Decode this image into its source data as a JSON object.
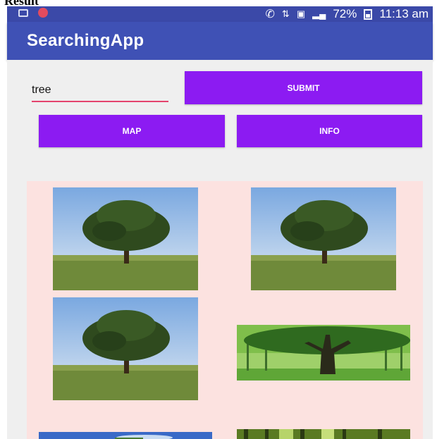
{
  "caption": "Result",
  "status_bar": {
    "battery": "72%",
    "time": "11:13 am",
    "icons": [
      "image-icon",
      "record-icon",
      "call-icon",
      "data-icon",
      "sim-icon",
      "signal-icon",
      "battery-icon"
    ]
  },
  "app": {
    "title": "SearchingApp",
    "accent_color": "#8c1bf2",
    "appbar_color": "#3f51b5"
  },
  "search": {
    "value": "tree"
  },
  "buttons": {
    "submit": "SUBMIT",
    "map": "MAP",
    "info": "INFO"
  },
  "results": {
    "images": [
      "tree-on-field-image",
      "tree-on-field-image",
      "tree-on-field-image",
      "tree-in-forest-image",
      "sky-landscape-image",
      "forest-image"
    ]
  }
}
